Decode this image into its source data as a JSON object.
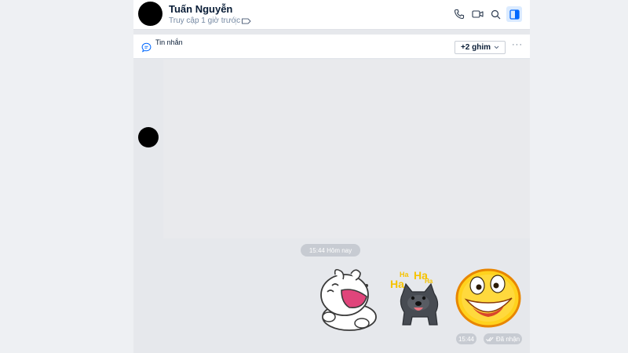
{
  "header": {
    "contact_name": "Tuấn Nguyễn",
    "status": "Truy cập 1 giờ trước",
    "icons": [
      "phone-icon",
      "video-call-icon",
      "search-icon",
      "sidebar-toggle-icon"
    ]
  },
  "pinbar": {
    "label": "Tin nhắn",
    "pin_button": "+2 ghim",
    "more": "···"
  },
  "messages": {
    "day_separator": "15:44 Hôm nay",
    "stickers": [
      "laughing-bunny-sticker",
      "haha-dog-sticker",
      "grinning-emoji-sticker"
    ],
    "time": "15:44",
    "receipt": "Đã nhận"
  },
  "colors": {
    "accent": "#0068ff",
    "active_bg": "#dbebff",
    "chat_bg": "#e6e8ec",
    "pill_bg": "#c7cbd2",
    "text_primary": "#081c36",
    "text_secondary": "#7589a3"
  },
  "haha_text": [
    "Ha",
    "Ha",
    "Ha",
    "Ha"
  ]
}
